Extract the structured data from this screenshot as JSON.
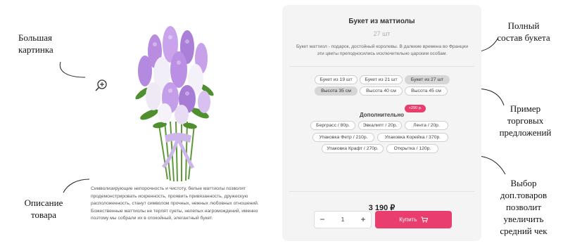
{
  "annotations": {
    "big_image": [
      "Большая",
      "картинка"
    ],
    "full_composition": [
      "Полный",
      "состав букета"
    ],
    "trade_offers": [
      "Пример",
      "торговых",
      "предложений"
    ],
    "extras": [
      "Выбор",
      "доп.товаров",
      "позволит",
      "увеличить",
      "средний чек"
    ],
    "description": [
      "Описание",
      "товара"
    ]
  },
  "product": {
    "image_icon": "flower-bouquet-image",
    "zoom_icon": "zoom-in-icon",
    "description": "Символизирующие непорочность и чистоту, белые маттиолы позволят продемонстрировать искренность, проявить привязанность, дружескую расположенность, станут символом прочных, нежных любовных отношений. Божественные маттиолы не терпят суеты, нелепых нагромождений, именно поэтому мы собрали их в спокойный, элегантный букет."
  },
  "card": {
    "title": "Букет из маттиолы",
    "quantity": "27 шт",
    "description": "Букет маттиол - подарок, достойный королевы. В далекие времена во Франции эти цветы преподносились исключительно царским особам.",
    "size_options": [
      {
        "label": "Букет из 19 шт",
        "active": false
      },
      {
        "label": "Букет из 21 шт",
        "active": false
      },
      {
        "label": "Букет из 27 шт",
        "active": true
      }
    ],
    "height_options": [
      {
        "label": "Высота 35 см",
        "active": true
      },
      {
        "label": "Высота 40 см",
        "active": false
      },
      {
        "label": "Высота 45 см",
        "active": false
      }
    ],
    "extras_label": "Дополнительно",
    "extras_badge": "+290 р.",
    "extras": [
      {
        "label": "Берграсс / 80р.",
        "active": false
      },
      {
        "label": "Эвкалипт / 20р.",
        "active": false
      },
      {
        "label": "Лента / 20р.",
        "active": false
      },
      {
        "label": "Упаковка Фетр / 210р.",
        "active": false
      },
      {
        "label": "Упаковка Корейка / 370р.",
        "active": false
      },
      {
        "label": "Упаковка Крафт / 270р.",
        "active": false
      },
      {
        "label": "Открытка / 120р.",
        "active": false
      }
    ],
    "price": "3 190 ₽",
    "stepper": {
      "minus": "−",
      "value": "1",
      "plus": "+"
    },
    "buy_label": "Купить",
    "cart_icon": "cart-icon",
    "accent_color": "#e93d6e",
    "active_chip_color": "#d6d6d6"
  }
}
